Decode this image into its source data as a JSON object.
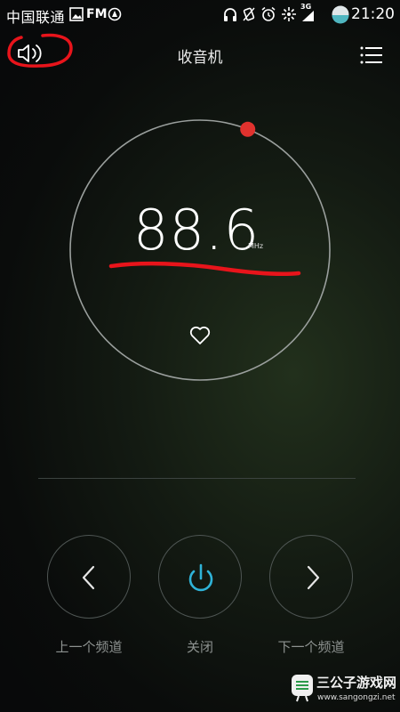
{
  "status_bar": {
    "carrier": "中国联通",
    "fm_indicator": "FM",
    "network": "3G",
    "time": "21:20"
  },
  "header": {
    "title": "收音机"
  },
  "radio": {
    "frequency": "88.6",
    "unit": "MHz",
    "tuning_position": 0.06
  },
  "controls": {
    "prev_label": "上一个频道",
    "power_label": "关闭",
    "next_label": "下一个频道"
  },
  "colors": {
    "accent_power": "#2fb3d8",
    "tuning_dot": "#e0322e",
    "annotation": "#e8141b"
  },
  "icons": [
    "speaker-icon",
    "menu-icon",
    "heart-icon",
    "chevron-left-icon",
    "power-icon",
    "chevron-right-icon"
  ],
  "watermark": {
    "name": "三公子游戏网",
    "url": "www.sangongzi.net"
  }
}
